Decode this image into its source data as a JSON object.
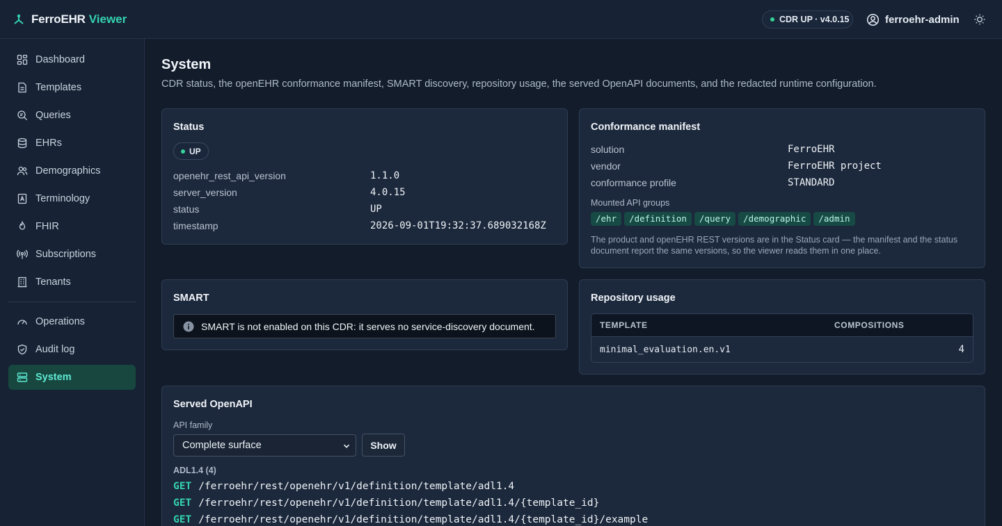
{
  "app": {
    "brand": "FerroEHR",
    "brand_accent": "Viewer"
  },
  "header": {
    "status_badge": "CDR UP · v4.0.15",
    "username": "ferroehr-admin"
  },
  "sidebar": {
    "items": [
      {
        "label": "Dashboard",
        "icon": "dashboard-icon"
      },
      {
        "label": "Templates",
        "icon": "templates-icon"
      },
      {
        "label": "Queries",
        "icon": "queries-icon"
      },
      {
        "label": "EHRs",
        "icon": "ehrs-icon"
      },
      {
        "label": "Demographics",
        "icon": "demographics-icon"
      },
      {
        "label": "Terminology",
        "icon": "terminology-icon"
      },
      {
        "label": "FHIR",
        "icon": "fhir-icon"
      },
      {
        "label": "Subscriptions",
        "icon": "subscriptions-icon"
      },
      {
        "label": "Tenants",
        "icon": "tenants-icon"
      }
    ],
    "admin_items": [
      {
        "label": "Operations",
        "icon": "operations-icon"
      },
      {
        "label": "Audit log",
        "icon": "audit-log-icon"
      },
      {
        "label": "System",
        "icon": "system-icon",
        "active": true
      }
    ]
  },
  "page": {
    "title": "System",
    "subtitle": "CDR status, the openEHR conformance manifest, SMART discovery, repository usage, the served OpenAPI documents, and the redacted runtime configuration."
  },
  "status_card": {
    "title": "Status",
    "badge": "UP",
    "rows": [
      {
        "label": "openehr_rest_api_version",
        "value": "1.1.0"
      },
      {
        "label": "server_version",
        "value": "4.0.15"
      },
      {
        "label": "status",
        "value": "UP"
      },
      {
        "label": "timestamp",
        "value": "2026-09-01T19:32:37.689032168Z"
      }
    ]
  },
  "conformance_card": {
    "title": "Conformance manifest",
    "rows": [
      {
        "label": "solution",
        "value": "FerroEHR"
      },
      {
        "label": "vendor",
        "value": "FerroEHR project"
      },
      {
        "label": "conformance profile",
        "value": "STANDARD"
      }
    ],
    "groups_label": "Mounted API groups",
    "groups": [
      "/ehr",
      "/definition",
      "/query",
      "/demographic",
      "/admin"
    ],
    "note": "The product and openEHR REST versions are in the Status card — the manifest and the status document report the same versions, so the viewer reads them in one place."
  },
  "smart_card": {
    "title": "SMART",
    "message": "SMART is not enabled on this CDR: it serves no service-discovery document."
  },
  "repository_card": {
    "title": "Repository usage",
    "columns": [
      "TEMPLATE",
      "COMPOSITIONS"
    ],
    "rows": [
      {
        "template": "minimal_evaluation.en.v1",
        "compositions": "4"
      }
    ]
  },
  "openapi_card": {
    "title": "Served OpenAPI",
    "family_label": "API family",
    "family_selected": "Complete surface",
    "show_label": "Show",
    "group_label": "ADL1.4 (4)",
    "endpoints": [
      {
        "method": "GET",
        "path": "/ferroehr/rest/openehr/v1/definition/template/adl1.4"
      },
      {
        "method": "GET",
        "path": "/ferroehr/rest/openehr/v1/definition/template/adl1.4/{template_id}"
      },
      {
        "method": "GET",
        "path": "/ferroehr/rest/openehr/v1/definition/template/adl1.4/{template_id}/example"
      }
    ]
  },
  "colors": {
    "accent": "#34d3b0",
    "status_ok": "#34d399",
    "background": "#121c2b"
  }
}
